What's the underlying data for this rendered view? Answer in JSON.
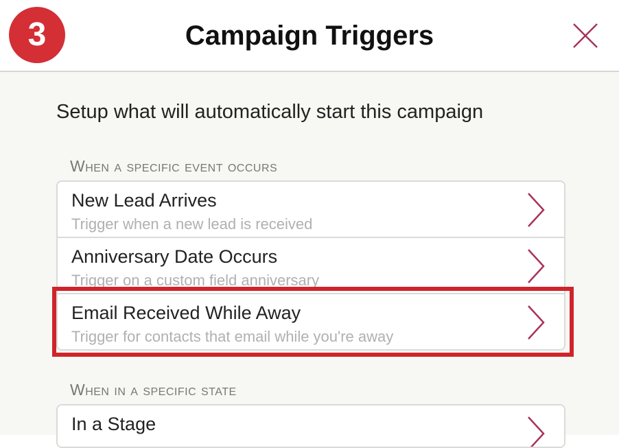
{
  "header": {
    "step_number": "3",
    "title": "Campaign Triggers",
    "close_icon": "close-icon"
  },
  "intro_text": "Setup what will automatically start this campaign",
  "sections": [
    {
      "heading": "When a specific event occurs",
      "items": [
        {
          "title": "New Lead Arrives",
          "subtitle": "Trigger when a new lead is received"
        },
        {
          "title": "Anniversary Date Occurs",
          "subtitle": "Trigger on a custom field anniversary"
        },
        {
          "title": "Email Received While Away",
          "subtitle": "Trigger for contacts that email while you're away",
          "highlighted": true
        }
      ]
    },
    {
      "heading": "When in a specific state",
      "items": [
        {
          "title": "In a Stage",
          "subtitle": ""
        }
      ]
    }
  ],
  "colors": {
    "badge": "#d32f35",
    "accent": "#a8325a",
    "highlight": "#d0242b",
    "background": "#f7f7f3"
  }
}
